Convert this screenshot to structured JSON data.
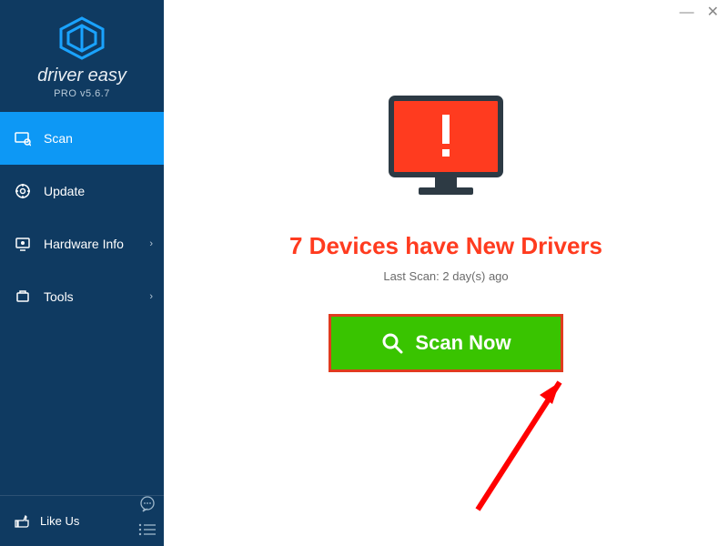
{
  "app": {
    "name": "driver easy",
    "version": "PRO v5.6.7"
  },
  "window": {
    "minimize": "—",
    "close": "✕"
  },
  "sidebar": {
    "items": [
      {
        "label": "Scan",
        "icon": "scan-icon",
        "active": true,
        "hasChevron": false
      },
      {
        "label": "Update",
        "icon": "update-icon",
        "active": false,
        "hasChevron": false
      },
      {
        "label": "Hardware Info",
        "icon": "hardware-icon",
        "active": false,
        "hasChevron": true
      },
      {
        "label": "Tools",
        "icon": "tools-icon",
        "active": false,
        "hasChevron": true
      }
    ],
    "footer": {
      "label": "Like Us"
    }
  },
  "main": {
    "headline": "7 Devices have New Drivers",
    "subline": "Last Scan: 2 day(s) ago",
    "button": "Scan Now"
  },
  "colors": {
    "accent": "#0d98f5",
    "alert": "#ff3b1f",
    "action": "#39c400",
    "sidebar": "#0f3a61"
  }
}
